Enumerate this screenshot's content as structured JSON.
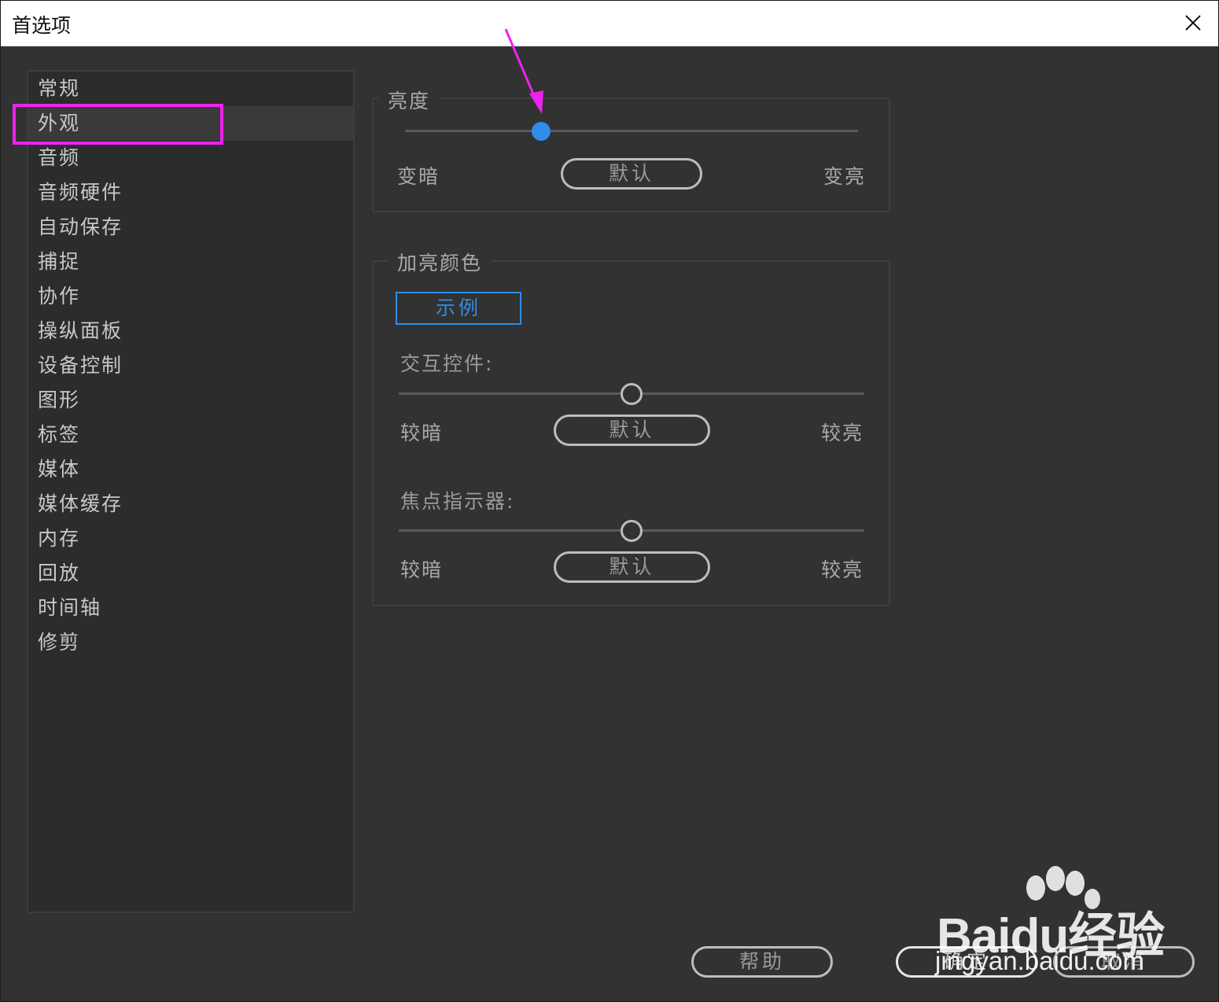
{
  "window": {
    "title": "首选项",
    "close_icon": "close-icon"
  },
  "sidebar": {
    "selected_index": 1,
    "items": [
      {
        "label": "常规"
      },
      {
        "label": "外观"
      },
      {
        "label": "音频"
      },
      {
        "label": "音频硬件"
      },
      {
        "label": "自动保存"
      },
      {
        "label": "捕捉"
      },
      {
        "label": "协作"
      },
      {
        "label": "操纵面板"
      },
      {
        "label": "设备控制"
      },
      {
        "label": "图形"
      },
      {
        "label": "标签"
      },
      {
        "label": "媒体"
      },
      {
        "label": "媒体缓存"
      },
      {
        "label": "内存"
      },
      {
        "label": "回放"
      },
      {
        "label": "时间轴"
      },
      {
        "label": "修剪"
      }
    ]
  },
  "brightness": {
    "legend": "亮度",
    "left_label": "变暗",
    "right_label": "变亮",
    "default_label": "默认",
    "level": 0.3
  },
  "highlight": {
    "legend": "加亮颜色",
    "sample_label": "示例",
    "interactive": {
      "label": "交互控件:",
      "left_label": "较暗",
      "right_label": "较亮",
      "default_label": "默认",
      "level": 0.5
    },
    "focus": {
      "label": "焦点指示器:",
      "left_label": "较暗",
      "right_label": "较亮",
      "default_label": "默认",
      "level": 0.5
    }
  },
  "footer": {
    "help_label": "帮助",
    "ok_label": "确定",
    "cancel_label": "取消"
  },
  "colors": {
    "accent": "#2f8ee8",
    "annotation": "#ee22ee",
    "background": "#323232"
  },
  "watermark": {
    "main": "Baidu经验",
    "url": "jingyan.baidu.com"
  }
}
